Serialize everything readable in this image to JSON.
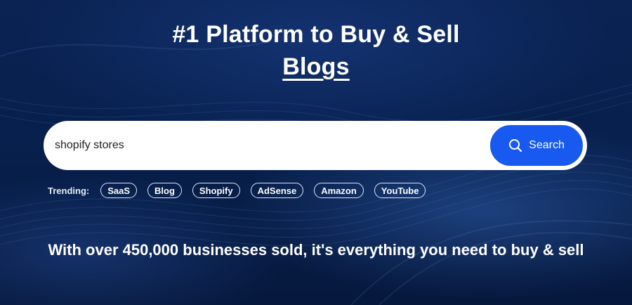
{
  "hero": {
    "title_line1": "#1 Platform to Buy & Sell",
    "title_line2": "Blogs"
  },
  "search": {
    "value": "shopify stores",
    "placeholder": "",
    "button_label": "Search",
    "button_color": "#1859F0"
  },
  "trending": {
    "label": "Trending:",
    "tags": [
      "SaaS",
      "Blog",
      "Shopify",
      "AdSense",
      "Amazon",
      "YouTube"
    ]
  },
  "tagline": "With over 450,000 businesses sold, it's everything you need to buy & sell",
  "colors": {
    "background": "#07204D",
    "text": "#FFFFFF",
    "accent": "#1859F0"
  }
}
